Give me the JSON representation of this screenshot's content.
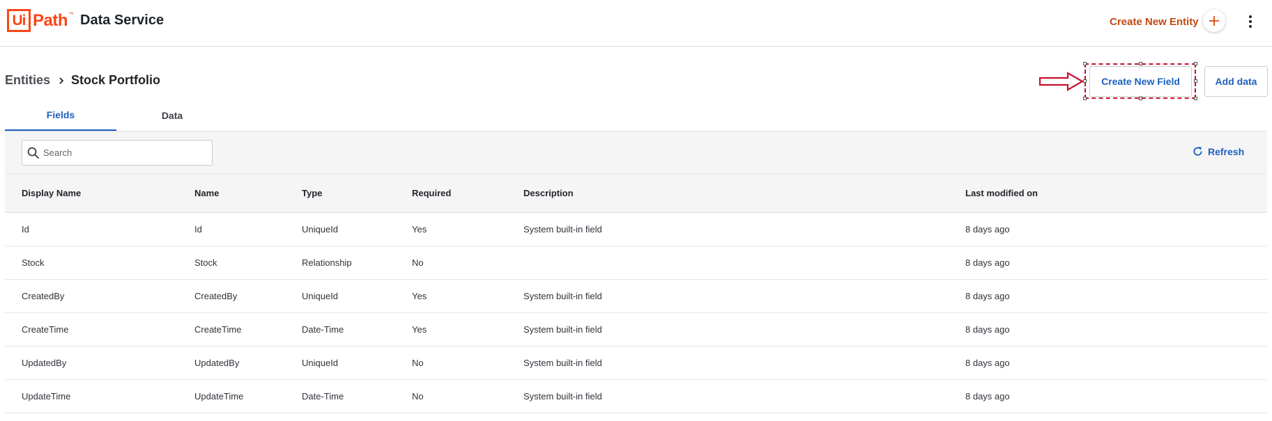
{
  "header": {
    "logo_ui": "Ui",
    "logo_path": "Path",
    "logo_tm": "™",
    "product_name": "Data Service",
    "create_entity_label": "Create New Entity"
  },
  "breadcrumb": {
    "parent": "Entities",
    "current": "Stock Portfolio"
  },
  "actions": {
    "create_field_label": "Create New Field",
    "add_data_label": "Add data"
  },
  "tabs": [
    {
      "label": "Fields",
      "active": true
    },
    {
      "label": "Data",
      "active": false
    }
  ],
  "toolbar": {
    "search_placeholder": "Search",
    "search_value": "",
    "refresh_label": "Refresh"
  },
  "table": {
    "columns": [
      "Display Name",
      "Name",
      "Type",
      "Required",
      "Description",
      "Last modified on"
    ],
    "rows": [
      {
        "display_name": "Id",
        "name": "Id",
        "type": "UniqueId",
        "required": "Yes",
        "description": "System built-in field",
        "modified": "8 days ago"
      },
      {
        "display_name": "Stock",
        "name": "Stock",
        "type": "Relationship",
        "required": "No",
        "description": "",
        "modified": "8 days ago"
      },
      {
        "display_name": "CreatedBy",
        "name": "CreatedBy",
        "type": "UniqueId",
        "required": "Yes",
        "description": "System built-in field",
        "modified": "8 days ago"
      },
      {
        "display_name": "CreateTime",
        "name": "CreateTime",
        "type": "Date-Time",
        "required": "Yes",
        "description": "System built-in field",
        "modified": "8 days ago"
      },
      {
        "display_name": "UpdatedBy",
        "name": "UpdatedBy",
        "type": "UniqueId",
        "required": "No",
        "description": "System built-in field",
        "modified": "8 days ago"
      },
      {
        "display_name": "UpdateTime",
        "name": "UpdateTime",
        "type": "Date-Time",
        "required": "No",
        "description": "System built-in field",
        "modified": "8 days ago"
      }
    ]
  },
  "colors": {
    "brand": "#fa4616",
    "accent": "#1d5fbf",
    "annotation": "#c8102e"
  },
  "icons": [
    "plus-icon",
    "more-vertical-icon",
    "chevron-right-icon",
    "search-icon",
    "refresh-icon",
    "arrow-right-annotation-icon"
  ]
}
